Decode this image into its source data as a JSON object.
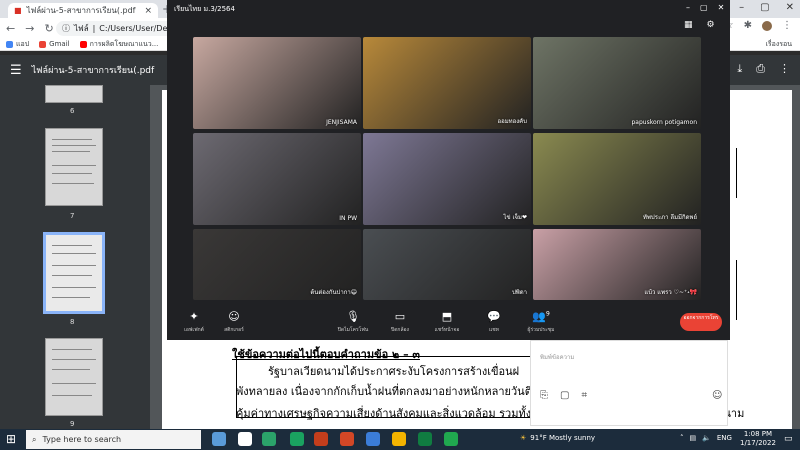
{
  "browser": {
    "tab_title": "ไฟล์ผ่าน-5-สาขาการเรียน(.pdf",
    "new_tab": "+",
    "url_prefix": "ไฟล์",
    "url": "C:/Users/User/Desktop",
    "bookmarks": [
      "แอป",
      "Gmail",
      "การผลิตโฆษณาแนว...",
      ""
    ],
    "bookmarks_right": "เรื่องรอน"
  },
  "pdf": {
    "filename": "ไฟล์ผ่าน-5-สาขาการเรียน(.pdf",
    "thumb_numbers": [
      "6",
      "7",
      "8",
      "9"
    ]
  },
  "document": {
    "heading": "ใช้ข้อความต่อไปนี้ตอบคำถามข้อ ๒ – ๓",
    "line1": "รัฐบาลเวียดนามได้ประกาศระงับโครงการสร้างเขื่อนฝ",
    "line2": "พังทลายลง  เนื่องจากกักเก็บน้ำฝนที่ตกลงมาอย่างหนักหลายวันติ",
    "line3": "คุ้มค่าทางเศรษฐกิจความเสี่ยงด้านสังคมและสิ่งแวดล้อม  รวมทั้งเป็นตัวการทำลายป่าไม้  ปัจจุบันนี้แม่เวียดนาม"
  },
  "meeting": {
    "title": "เรียนไทย ม.3/2564",
    "tiles": [
      {
        "name": "JENJISAMA",
        "color": "#c7a8a0"
      },
      {
        "name": "ออมทองคับ",
        "color": "#b8893a"
      },
      {
        "name": "papuskorn potigamon",
        "color": "#6e7465"
      },
      {
        "name": "IN PW",
        "color": "#6d6a72"
      },
      {
        "name": "ไข่ เจ็ม❤",
        "color": "#7e7895"
      },
      {
        "name": "ทัพประภา ลีมมีกิดพย์",
        "color": "#8a8a50"
      },
      {
        "name": "ต้นต่องกันปากา😄",
        "color": "#3a3837"
      },
      {
        "name": "ปพิดา",
        "color": "#4a4e52"
      },
      {
        "name": "แบ้ว แพรว ♡~⁺˖🎀",
        "color": "#c9a0a6"
      }
    ],
    "controls": [
      {
        "icon": "✦",
        "label": "เอฟเฟกต์"
      },
      {
        "icon": "☺",
        "label": "สติกเกอร์"
      },
      {
        "icon": "🎙",
        "label": "ปิดไมโครโฟน"
      },
      {
        "icon": "▭",
        "label": "ปิดกล้อง"
      },
      {
        "icon": "⬒",
        "label": "แชร์หน้าจอ"
      },
      {
        "icon": "💬",
        "label": "แชท"
      },
      {
        "icon": "👥",
        "label": "ผู้ร่วมประชุม"
      }
    ],
    "participant_count": "9",
    "leave_label": "ออกจากการโทร"
  },
  "chat": {
    "placeholder": "พิมพ์ข้อความ"
  },
  "taskbar": {
    "search_placeholder": "Type here to search",
    "weather": "91°F  Mostly sunny",
    "lang": "ENG",
    "time": "1:08 PM",
    "date": "1/17/2022"
  }
}
